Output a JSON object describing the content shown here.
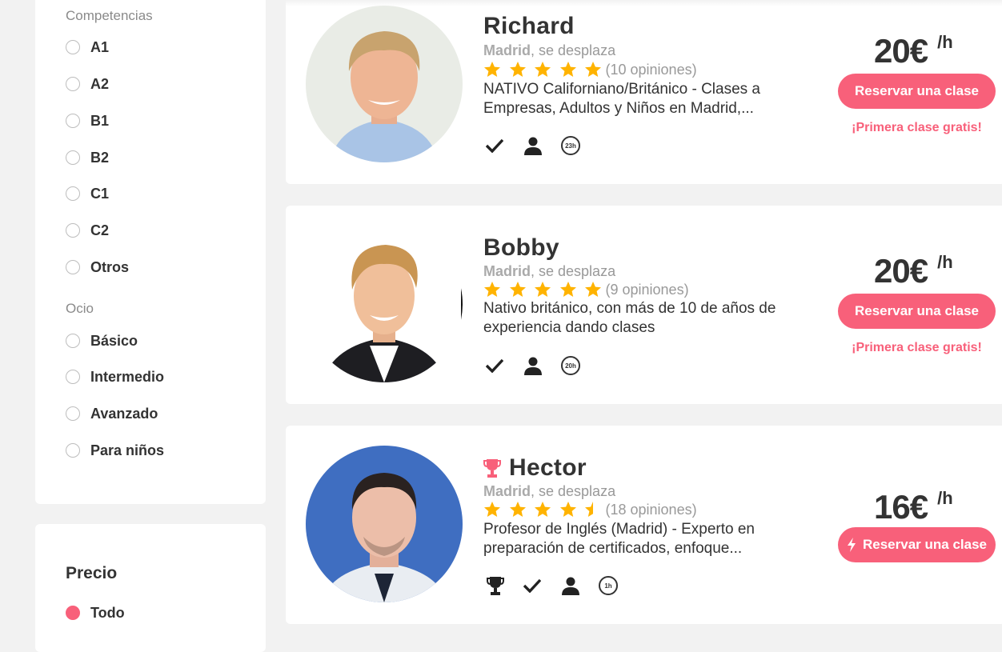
{
  "filters": {
    "competencias": {
      "title": "Competencias",
      "options": [
        "A1",
        "A2",
        "B1",
        "B2",
        "C1",
        "C2",
        "Otros"
      ]
    },
    "ocio": {
      "title": "Ocio",
      "options": [
        "Básico",
        "Intermedio",
        "Avanzado",
        "Para niños"
      ]
    },
    "precio": {
      "title": "Precio",
      "selected_option": "Todo"
    }
  },
  "teachers": [
    {
      "name": "Richard",
      "city": "Madrid",
      "travel": ", se desplaza",
      "rating": 5,
      "reviews": "(10 opiniones)",
      "description": "NATIVO Californiano/Británico - Clases a Empresas, Adultos y Niños en Madrid,...",
      "hours_badge": "23h",
      "price": "20€",
      "unit": "/h",
      "book_label": "Reservar una clase",
      "promo": "¡Primera clase gratis!"
    },
    {
      "name": "Bobby",
      "city": "Madrid",
      "travel": ", se desplaza",
      "rating": 5,
      "reviews": "(9 opiniones)",
      "description": "Nativo británico, con más de 10 de años de experiencia dando clases",
      "hours_badge": "20h",
      "price": "20€",
      "unit": "/h",
      "book_label": "Reservar una clase",
      "promo": "¡Primera clase gratis!"
    },
    {
      "name": "Hector",
      "city": "Madrid",
      "travel": ", se desplaza",
      "rating": 4.5,
      "reviews": "(18 opiniones)",
      "description": "Profesor de Inglés (Madrid) - Experto en preparación de certificados, enfoque...",
      "hours_badge": "1h",
      "price": "16€",
      "unit": "/h",
      "book_label": "Reservar una clase"
    }
  ],
  "colors": {
    "accent": "#f8607a",
    "star": "#ffb300",
    "text": "#333333",
    "muted": "#999999",
    "background": "#f2f2f2"
  },
  "icons": {
    "verified": "checkmark-icon",
    "profile": "person-icon",
    "response_time": "clock-badge-icon",
    "ambassador": "trophy-icon",
    "instant_book": "lightning-icon"
  }
}
